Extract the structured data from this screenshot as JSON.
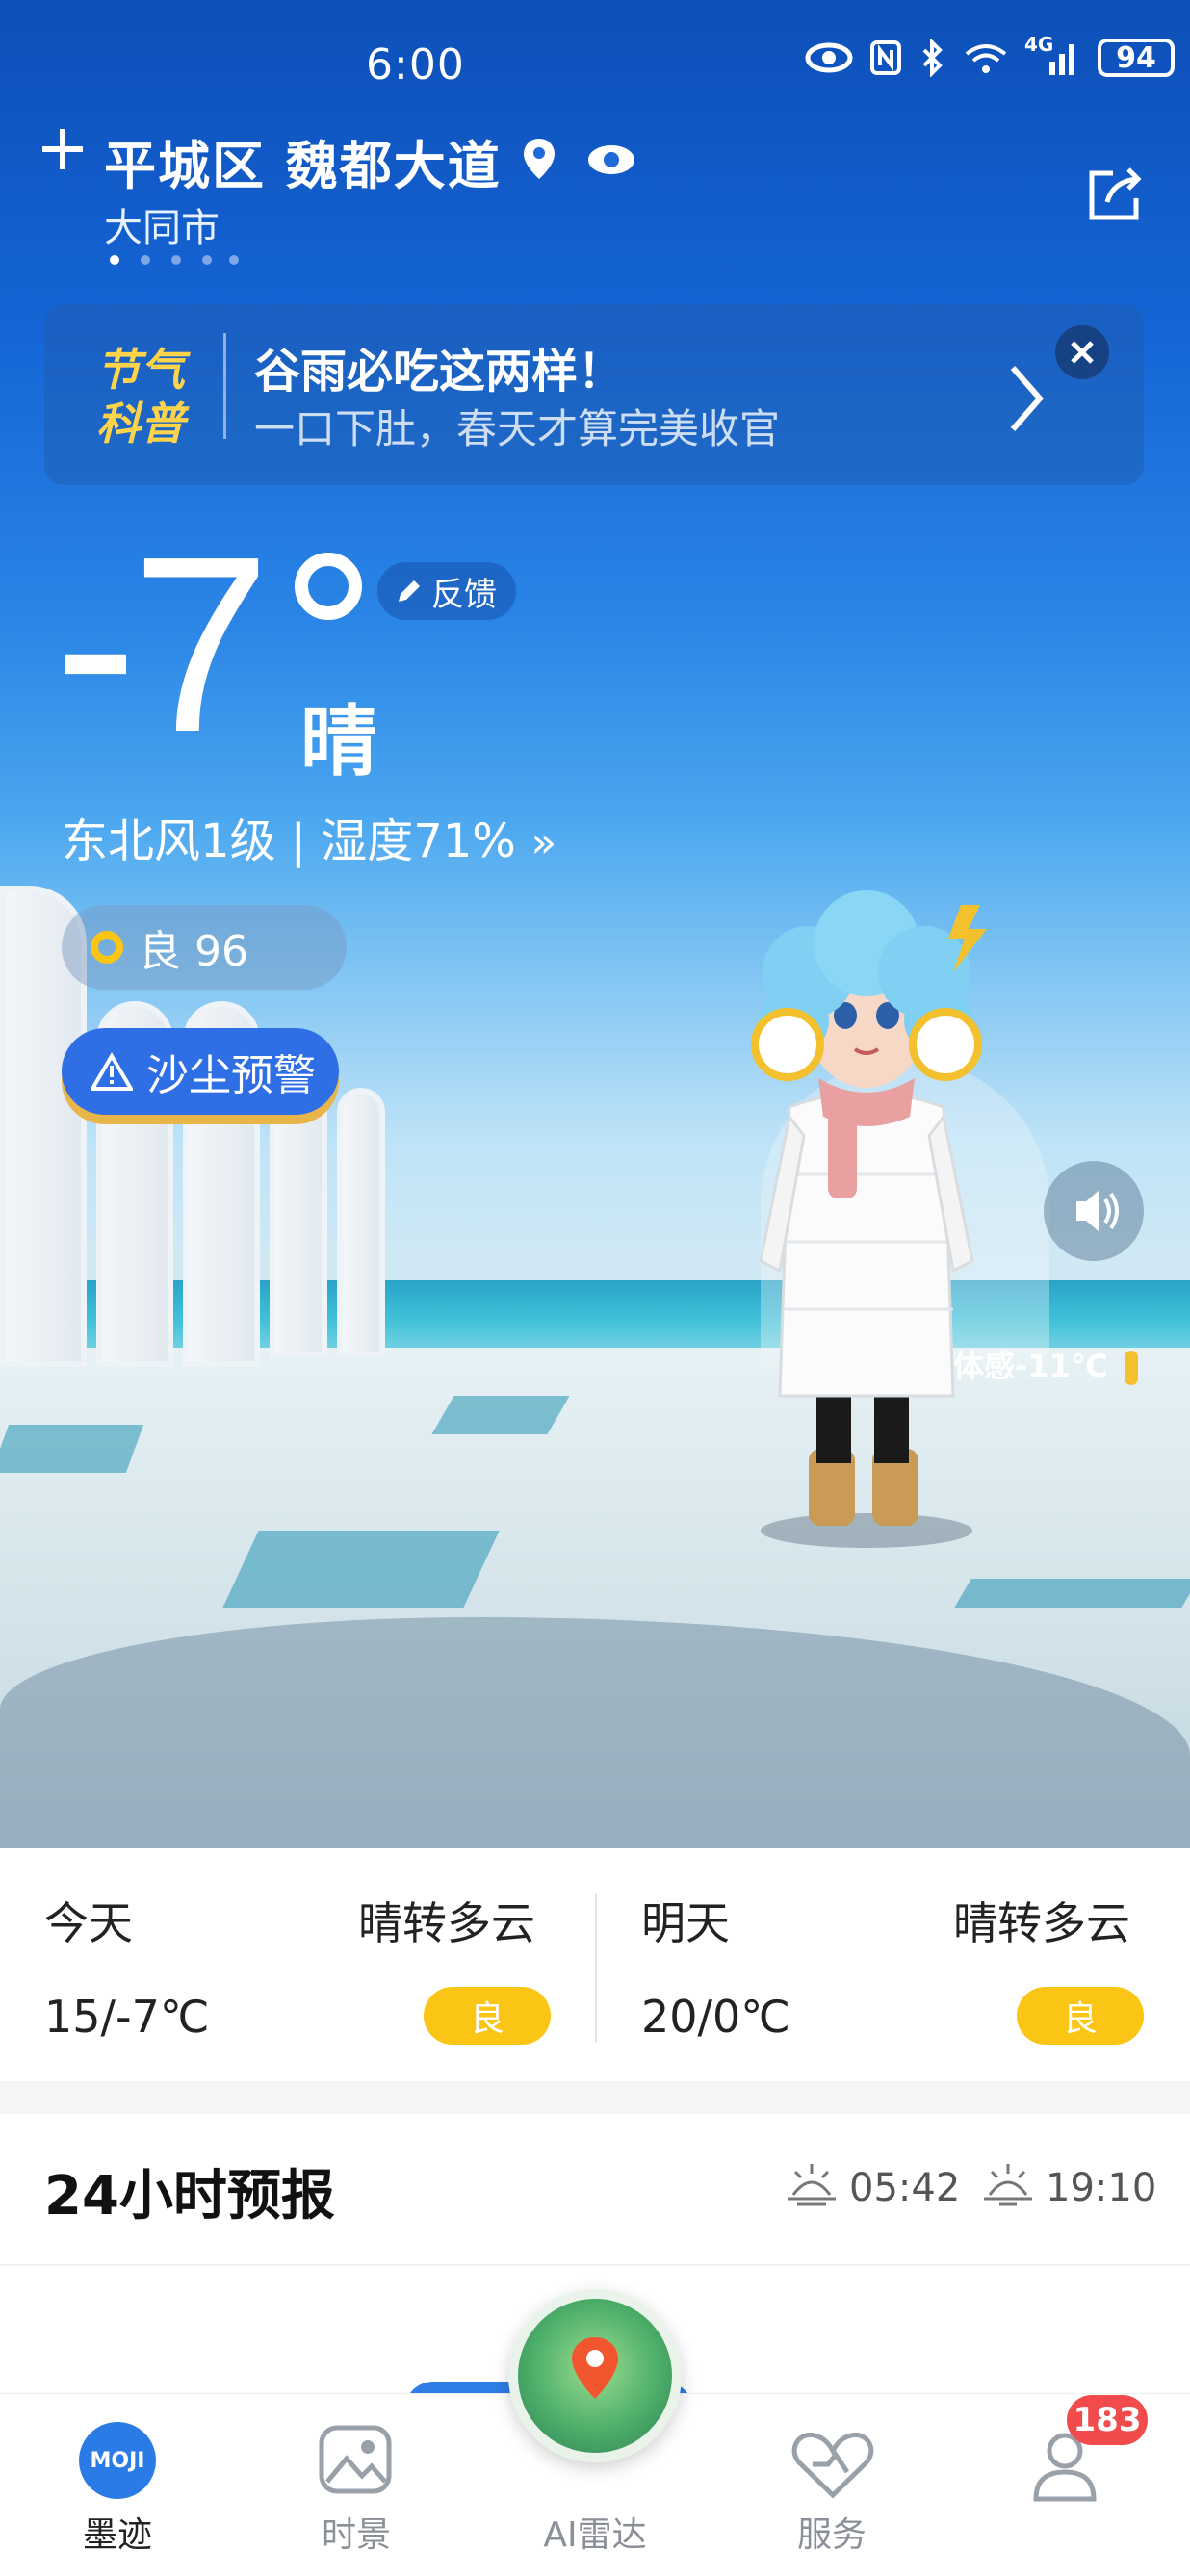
{
  "status_bar": {
    "time": "6:00",
    "battery": "94",
    "network": "4G"
  },
  "location": {
    "title": "平城区 魏都大道",
    "subtitle": "大同市",
    "page_count": 5,
    "active_page": 0
  },
  "banner": {
    "logo_line1": "节气",
    "logo_line2": "科普",
    "title": "谷雨必吃这两样！",
    "subtitle": "一口下肚，春天才算完美收官"
  },
  "current": {
    "temperature": "-7",
    "condition": "晴",
    "feedback_label": "反馈",
    "wind_humidity": "东北风1级 | 湿度71%",
    "aqi_label": "良 96",
    "alert_label": "沙尘预警",
    "feels_like": "体感-11℃"
  },
  "days": [
    {
      "name": "今天",
      "condition": "晴转多云",
      "temps": "15/-7℃",
      "aqi": "良"
    },
    {
      "name": "明天",
      "condition": "晴转多云",
      "temps": "20/0℃",
      "aqi": "良"
    }
  ],
  "hourly": {
    "title": "24小时预报",
    "sunrise": "05:42",
    "sunset": "19:10"
  },
  "tabs": [
    {
      "label": "墨迹",
      "logo": "MOJI"
    },
    {
      "label": "时景"
    },
    {
      "label": "AI雷达"
    },
    {
      "label": "服务"
    },
    {
      "label": "",
      "badge": "183"
    }
  ],
  "colors": {
    "accent_blue": "#2f6fe6",
    "aqi_yellow": "#fbc515",
    "badge_red": "#f24b4b",
    "banner_gold": "#ffd34a"
  }
}
